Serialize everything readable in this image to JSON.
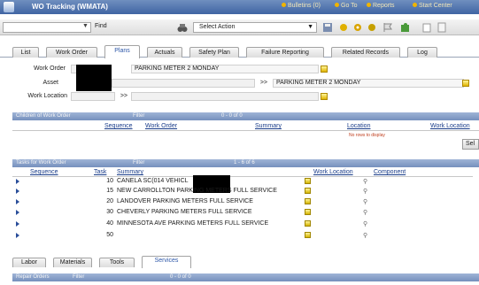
{
  "window": {
    "title": "WO Tracking (WMATA)"
  },
  "header_links": {
    "bulletins": "Bulletins (0)",
    "goto": "Go To",
    "reports": "Reports",
    "start_center": "Start Center"
  },
  "toolbar": {
    "find_label": "Find",
    "select_action": "Select Action"
  },
  "tabs": [
    "List",
    "Work Order",
    "Plans",
    "Actuals",
    "Safety Plan",
    "Failure Reporting",
    "Related Records",
    "Log"
  ],
  "active_tab": "Plans",
  "form": {
    "work_order_label": "Work Order",
    "work_order_desc": "PARKING METER 2 MONDAY",
    "asset_label": "Asset",
    "asset_desc": "PARKING METER 2 MONDAY",
    "work_location_label": "Work Location",
    "work_location_arrow": ">>",
    "asset_arrow": ">>"
  },
  "children_section": {
    "title": "Children of Work Order",
    "filter": "Filter",
    "paging": "0 - 0 of 0",
    "columns": [
      "Sequence",
      "Work Order",
      "Summary",
      "Location",
      "Work Location"
    ],
    "empty_message": "No rows to display",
    "select_button": "Sel"
  },
  "tasks_section": {
    "title": "Tasks for Work Order",
    "filter": "Filter",
    "paging": "1 - 6 of 6",
    "columns": [
      "Sequence",
      "Task",
      "Summary",
      "Work Location",
      "Component"
    ],
    "rows": [
      {
        "task": "10",
        "summary": "CANELA SC(014 VEHICL"
      },
      {
        "task": "15",
        "summary": "NEW CARROLLTON PARKING METERS FULL SERVICE"
      },
      {
        "task": "20",
        "summary": "LANDOVER PARKING METERS FULL SERVICE"
      },
      {
        "task": "30",
        "summary": "CHEVERLY PARKING METERS FULL SERVICE"
      },
      {
        "task": "40",
        "summary": "MINNESOTA AVE PARKING METERS FULL SERVICE"
      },
      {
        "task": "50",
        "summary": ""
      }
    ]
  },
  "bottom_tabs": [
    "Labor",
    "Materials",
    "Tools",
    "Services"
  ],
  "active_bottom_tab": "Services",
  "bottom_bar": {
    "title": "Repair Orders",
    "filter": "Filter",
    "paging": "0 - 0 of 0"
  }
}
